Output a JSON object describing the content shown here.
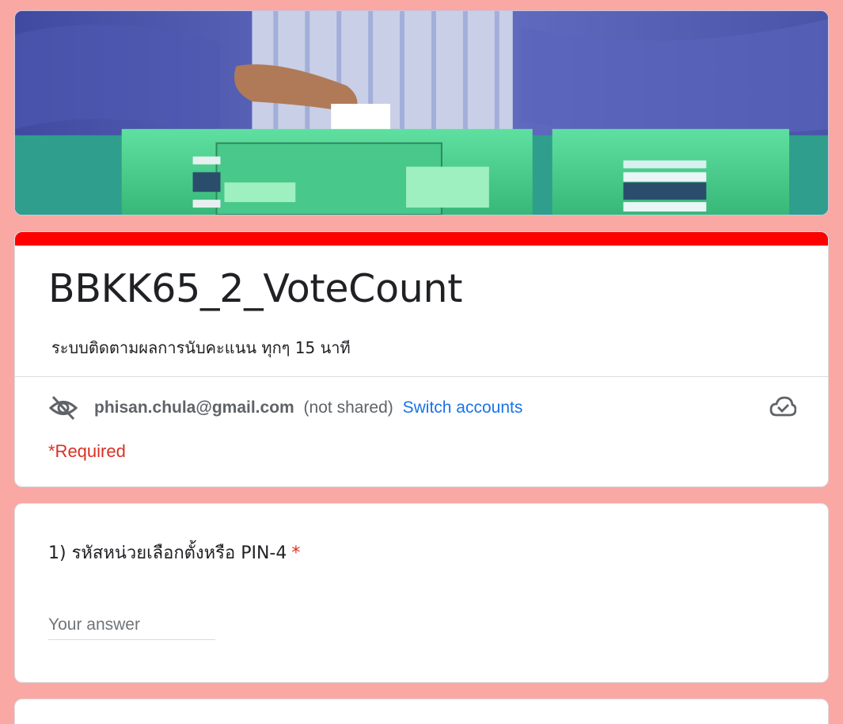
{
  "form": {
    "title": "BBKK65_2_VoteCount",
    "description": "ระบบติดตามผลการนับคะแนน ทุกๆ 15 นาที",
    "accent_color": "#ff0000",
    "background_color": "#f9a8a4"
  },
  "account": {
    "email": "phisan.chula@gmail.com",
    "shared_status": "(not shared)",
    "switch_label": "Switch accounts",
    "eye_icon": "visibility-off-icon",
    "cloud_icon": "cloud-done-icon"
  },
  "required_note": "*Required",
  "questions": [
    {
      "label": "1) รหัสหน่วยเลือกตั้งหรือ PIN-4",
      "required_marker": "*",
      "placeholder": "Your answer",
      "value": ""
    }
  ],
  "banner": {
    "image": "ballot-box-photo"
  }
}
